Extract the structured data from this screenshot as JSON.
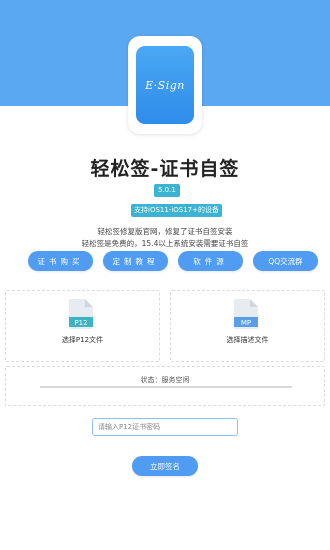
{
  "colors": {
    "brand_blue": "#5aa8f0",
    "button_blue": "#4f9cf2",
    "badge_teal": "#3bb4d4"
  },
  "logo": {
    "text": "E·Sign"
  },
  "header": {
    "title": "轻松签-证书自签",
    "version": "5.0.1",
    "support": "支持iOS11-iOS17+的设备",
    "desc_line1": "轻松签修复版官网，修复了证书自签安装",
    "desc_line2": "轻松签是免费的，15.4以上系统安装需要证书自签"
  },
  "buttons": [
    {
      "label": "证书购买"
    },
    {
      "label": "定制教程"
    },
    {
      "label": "软件源"
    },
    {
      "label": "QQ交流群"
    }
  ],
  "files": {
    "p12": {
      "icon": "file-p12-icon",
      "tag": "P12",
      "label": "选择P12文件"
    },
    "mp": {
      "icon": "file-mp-icon",
      "tag": "MP",
      "label": "选择描述文件"
    }
  },
  "status": {
    "text": "状态：服务空闲"
  },
  "password": {
    "placeholder": "请输入P12证书密码"
  },
  "submit": {
    "label": "立即签名"
  }
}
